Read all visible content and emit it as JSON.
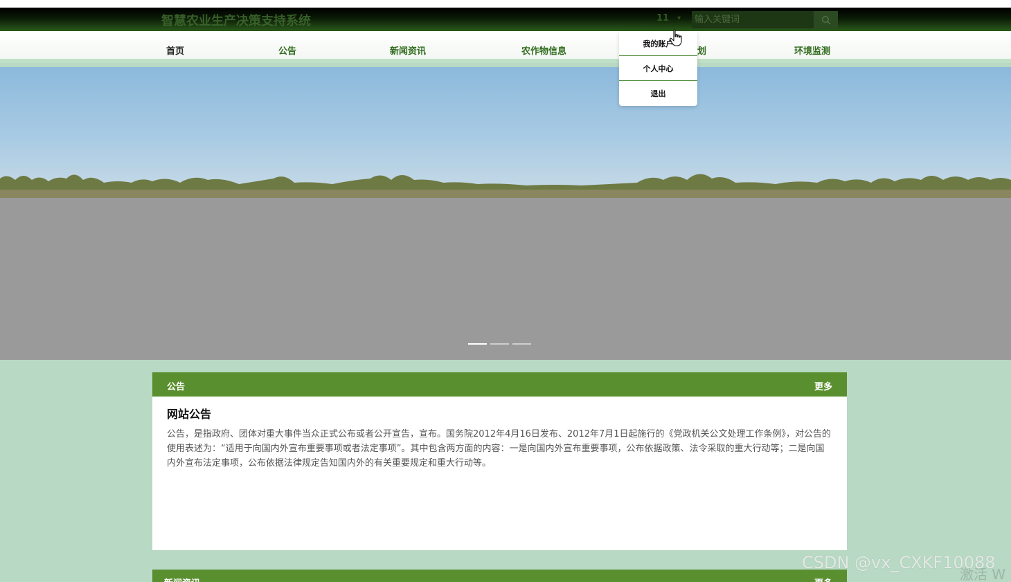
{
  "header": {
    "site_title": "智慧农业生产决策支持系统",
    "user_label": "11",
    "user_caret": "▾",
    "search_placeholder": "输入关键词"
  },
  "nav": {
    "items": [
      {
        "label": "首页"
      },
      {
        "label": "公告"
      },
      {
        "label": "新闻资讯"
      },
      {
        "label": "农作物信息"
      },
      {
        "label": "种植计划"
      },
      {
        "label": "环境监测"
      }
    ],
    "visible_partial_label": "划"
  },
  "user_menu": {
    "items": [
      {
        "label": "我的账户"
      },
      {
        "label": "个人中心"
      },
      {
        "label": "退出"
      }
    ]
  },
  "carousel": {
    "slide_count": 3,
    "active_index": 0
  },
  "notice_panel": {
    "title": "公告",
    "more_label": "更多",
    "heading": "网站公告",
    "body": "公告，是指政府、团体对重大事件当众正式公布或者公开宣告，宣布。国务院2012年4月16日发布、2012年7月1日起施行的《党政机关公文处理工作条例》，对公告的使用表述为：“适用于向国内外宣布重要事项或者法定事项”。其中包含两方面的内容：一是向国内外宣布重要事项，公布依据政策、法令采取的重大行动等；二是向国内外宣布法定事项，公布依据法律规定告知国内外的有关重要规定和重大行动等。"
  },
  "news_panel": {
    "title": "新闻资讯",
    "more_label": "更多"
  },
  "overlay": {
    "watermark": "CSDN @vx_CXKF10088",
    "activate_text": "激活 W"
  },
  "colors": {
    "header_dark": "#000000",
    "accent_green": "#5a8f2f",
    "nav_green": "#2f6b1d",
    "page_bg": "#b8d9c4"
  }
}
